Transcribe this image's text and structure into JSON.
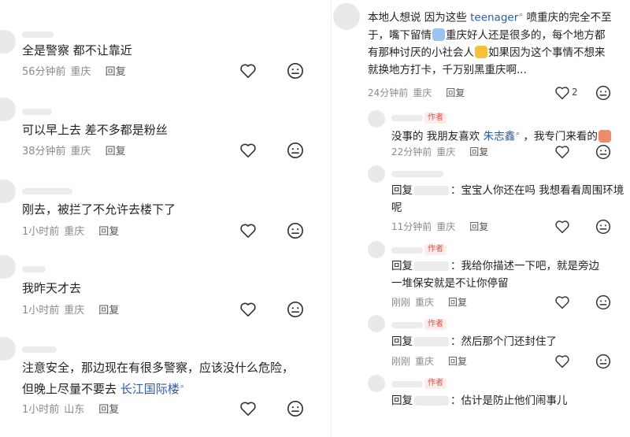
{
  "left_panel": {
    "comments": [
      {
        "text": "全是警察 都不让靠近",
        "time": "56分钟前",
        "location": "重庆",
        "reply": "回复"
      },
      {
        "text": "可以早上去 差不多都是粉丝",
        "time": "38分钟前",
        "location": "重庆",
        "reply": "回复"
      },
      {
        "text": "刚去，被拦了不允许去楼下了",
        "time": "1小时前",
        "location": "重庆",
        "reply": "回复"
      },
      {
        "text": "我昨天才去",
        "time": "1小时前",
        "location": "重庆",
        "reply": "回复"
      },
      {
        "text_line1": "注意安全，那边现在有很多警察，应该没什么危险，",
        "text_line2_prefix": "但晚上尽量不要去 ",
        "text_link": "长江国际楼",
        "time": "1小时前",
        "location": "山东",
        "reply": "回复"
      }
    ]
  },
  "right_panel": {
    "main_comment": {
      "line1_a": "本地人想说 因为这些 ",
      "line1_link": "teenager",
      "line1_b": " 喷重庆的完全不至",
      "line2_a": "于，嘴下留情",
      "line2_b": "重庆好人还是很多的，每个地方都",
      "line3_a": "有那种讨厌的小社会人",
      "line3_b": "如果因为这个事情不想来",
      "line4": "就换地方打卡，千万别黑重庆啊...",
      "time": "24分钟前",
      "location": "重庆",
      "reply": "回复",
      "like_count": "2"
    },
    "replies": [
      {
        "author_badge": "作者",
        "text_a": "没事的 我朋友喜欢 ",
        "text_link": "朱志鑫",
        "text_b": " ，我专门来看的",
        "time": "22分钟前",
        "location": "重庆",
        "reply": "回复"
      },
      {
        "prefix": "回复",
        "line1": "：宝宝人你还在吗 我想看看周围环境",
        "line2": "呢",
        "time": "11分钟前",
        "location": "重庆",
        "reply": "回复"
      },
      {
        "author_badge": "作者",
        "prefix": "回复",
        "line1": "：我给你描述一下吧，就是旁边",
        "line2": "一堆保安就是不让你停留",
        "time": "刚刚",
        "location": "重庆",
        "reply": "回复"
      },
      {
        "author_badge": "作者",
        "prefix": "回复",
        "line1": "：然后那个门还封住了",
        "time": "刚刚",
        "location": "重庆",
        "reply": "回复"
      },
      {
        "author_badge": "作者",
        "prefix": "回复",
        "line1": "：估计是防止他们闹事儿"
      }
    ]
  },
  "icons": {
    "like": "heart-outline-icon",
    "dislike": "neutral-face-icon"
  },
  "colors": {
    "link": "#2b5aa8",
    "meta": "#8a8a8a",
    "author_badge": "#e0504a"
  }
}
